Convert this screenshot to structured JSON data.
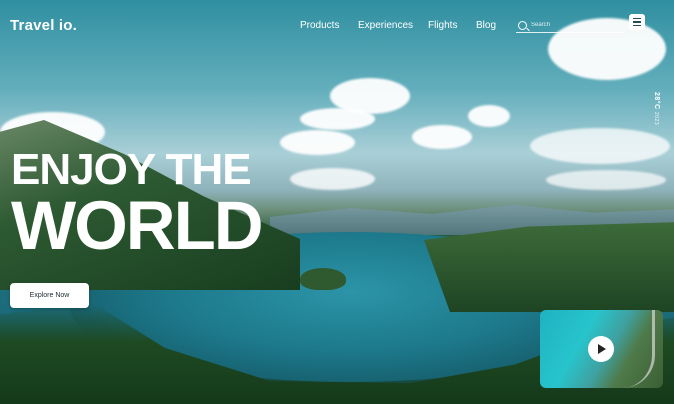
{
  "brand": {
    "logo": "Travel io."
  },
  "nav": {
    "items": [
      "Products",
      "Experiences",
      "Flights",
      "Blog"
    ],
    "search_placeholder": "Search"
  },
  "side_info": {
    "main": "28°C",
    "sub": "2023"
  },
  "hero": {
    "line1": "ENJOY THE",
    "line2": "WORLD",
    "cta_label": "Explore Now"
  },
  "video": {
    "icon": "play-icon"
  },
  "colors": {
    "accent": "#ffffff",
    "sky": "#2f8fa0",
    "water": "#1d7a8c",
    "forest": "#1e4a22"
  }
}
